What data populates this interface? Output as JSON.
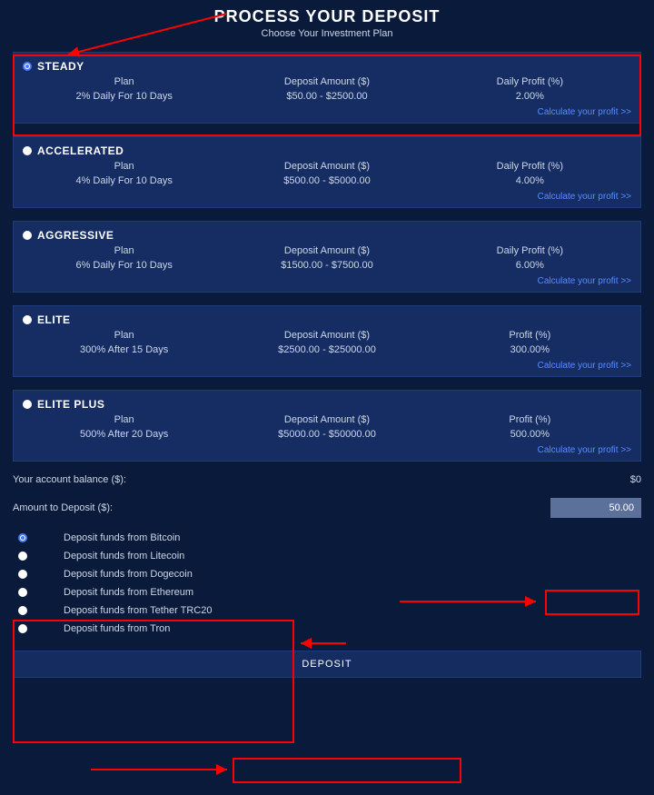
{
  "header": {
    "title": "PROCESS YOUR DEPOSIT",
    "subtitle": "Choose Your Investment Plan"
  },
  "plans": [
    {
      "name": "STEADY",
      "selected": true,
      "col_plan": "Plan",
      "col_amount": "Deposit Amount ($)",
      "col_profit": "Daily Profit (%)",
      "val_plan": "2% Daily For 10 Days",
      "val_amount": "$50.00 - $2500.00",
      "val_profit": "2.00%",
      "calc": "Calculate your profit >>"
    },
    {
      "name": "ACCELERATED",
      "selected": false,
      "col_plan": "Plan",
      "col_amount": "Deposit Amount ($)",
      "col_profit": "Daily Profit (%)",
      "val_plan": "4% Daily For 10 Days",
      "val_amount": "$500.00 - $5000.00",
      "val_profit": "4.00%",
      "calc": "Calculate your profit >>"
    },
    {
      "name": "AGGRESSIVE",
      "selected": false,
      "col_plan": "Plan",
      "col_amount": "Deposit Amount ($)",
      "col_profit": "Daily Profit (%)",
      "val_plan": "6% Daily For 10 Days",
      "val_amount": "$1500.00 - $7500.00",
      "val_profit": "6.00%",
      "calc": "Calculate your profit >>"
    },
    {
      "name": "ELITE",
      "selected": false,
      "col_plan": "Plan",
      "col_amount": "Deposit Amount ($)",
      "col_profit": "Profit (%)",
      "val_plan": "300% After 15 Days",
      "val_amount": "$2500.00 - $25000.00",
      "val_profit": "300.00%",
      "calc": "Calculate your profit >>"
    },
    {
      "name": "ELITE PLUS",
      "selected": false,
      "col_plan": "Plan",
      "col_amount": "Deposit Amount ($)",
      "col_profit": "Profit (%)",
      "val_plan": "500% After 20 Days",
      "val_amount": "$5000.00 - $50000.00",
      "val_profit": "500.00%",
      "calc": "Calculate your profit >>"
    }
  ],
  "balance": {
    "label": "Your account balance ($):",
    "value": "$0"
  },
  "amount": {
    "label": "Amount to Deposit ($):",
    "value": "50.00"
  },
  "payments": [
    {
      "label": "Deposit funds from Bitcoin",
      "selected": true
    },
    {
      "label": "Deposit funds from Litecoin",
      "selected": false
    },
    {
      "label": "Deposit funds from Dogecoin",
      "selected": false
    },
    {
      "label": "Deposit funds from Ethereum",
      "selected": false
    },
    {
      "label": "Deposit funds from Tether TRC20",
      "selected": false
    },
    {
      "label": "Deposit funds from Tron",
      "selected": false
    }
  ],
  "deposit_button": "DEPOSIT"
}
